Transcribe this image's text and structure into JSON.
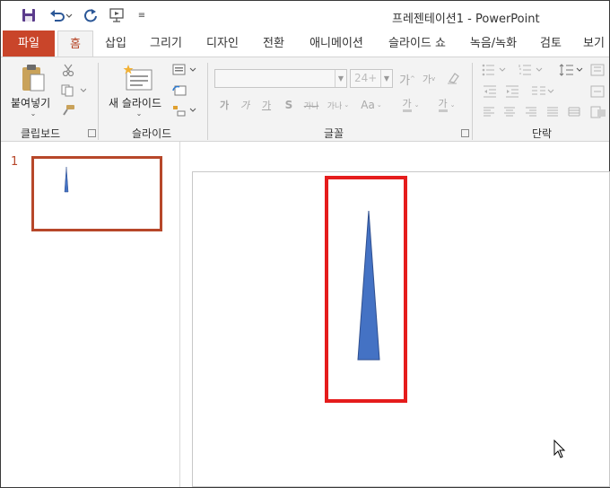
{
  "window": {
    "title": "프레젠테이션1  -  PowerPoint"
  },
  "quick_access": {
    "save_icon": "save-icon",
    "undo_icon": "undo-icon",
    "redo_icon": "redo-icon",
    "present_icon": "start-from-beginning-icon",
    "customize_icon": "customize-qat-icon"
  },
  "tabs": [
    {
      "label": "파일"
    },
    {
      "label": "홈"
    },
    {
      "label": "삽입"
    },
    {
      "label": "그리기"
    },
    {
      "label": "디자인"
    },
    {
      "label": "전환"
    },
    {
      "label": "애니메이션"
    },
    {
      "label": "슬라이드 쇼"
    },
    {
      "label": "녹음/녹화"
    },
    {
      "label": "검토"
    },
    {
      "label": "보기"
    }
  ],
  "ribbon": {
    "clipboard": {
      "paste_label": "붙여넣기",
      "group_label": "클립보드"
    },
    "slides": {
      "new_slide_label": "새 슬라이드",
      "group_label": "슬라이드"
    },
    "font": {
      "font_size_value": "24+",
      "grow_label": "가",
      "shrink_label": "가",
      "bold_label": "가",
      "italic_label": "가",
      "underline_label": "가",
      "shadow_label": "S",
      "strike_label": "가나",
      "spacing_label": "가나",
      "case_label": "Aa",
      "highlight_label": "가",
      "color_label": "가",
      "group_label": "글꼴"
    },
    "paragraph": {
      "group_label": "단락"
    }
  },
  "slides_panel": {
    "slide_number": "1"
  },
  "colors": {
    "accent": "#b7472a",
    "file_tab": "#c9452a",
    "selection_box": "#e51c1c",
    "shape_fill": "#4472c4",
    "shape_stroke": "#2f4f8f"
  }
}
